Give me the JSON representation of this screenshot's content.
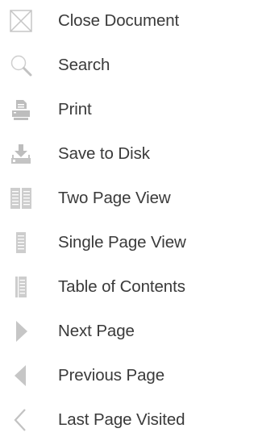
{
  "menu": {
    "items": [
      {
        "label": "Close Document",
        "icon": "close-document-icon"
      },
      {
        "label": "Search",
        "icon": "search-icon"
      },
      {
        "label": "Print",
        "icon": "print-icon"
      },
      {
        "label": "Save to Disk",
        "icon": "save-to-disk-icon"
      },
      {
        "label": "Two Page View",
        "icon": "two-page-view-icon"
      },
      {
        "label": "Single Page View",
        "icon": "single-page-view-icon"
      },
      {
        "label": "Table of Contents",
        "icon": "table-of-contents-icon"
      },
      {
        "label": "Next Page",
        "icon": "next-page-icon"
      },
      {
        "label": "Previous Page",
        "icon": "previous-page-icon"
      },
      {
        "label": "Last Page Visited",
        "icon": "last-page-visited-icon"
      }
    ]
  },
  "colors": {
    "text": "#3a3a3a",
    "icon": "#c8c8c8",
    "icon_dark": "#b4b4b4"
  }
}
